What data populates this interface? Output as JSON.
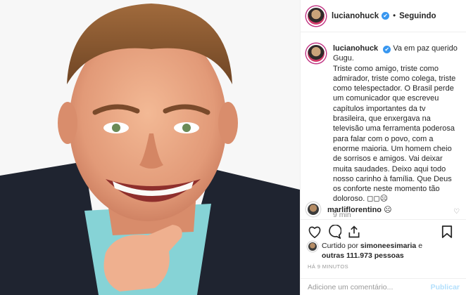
{
  "header": {
    "username": "lucianohuck",
    "verified_badge": "✔",
    "separator": "•",
    "follow_label": "Seguindo"
  },
  "caption": {
    "username": "lucianohuck",
    "first_line": "Va em paz querido Gugu.",
    "body": "Triste como amigo, triste como admirador, triste como colega, triste como telespectador. O Brasil perde um comunicador que escreveu capítulos importantes da tv brasileira, que enxergava na televisão uma ferramenta poderosa para falar com o povo, com a enorme maioria. Um homem cheio de sorrisos e amigos. Vai deixar muita saudades. Deixo aqui todo nosso carinho à família. Que Deus os conforte neste momento tão doloroso. ◻◻☹",
    "time": "9 min"
  },
  "comment": {
    "username": "marliflorentino",
    "text": "☹"
  },
  "likes": {
    "prefix": "Curtido por",
    "user": "simoneesimaria",
    "middle": "e",
    "others": "outras 111.973 pessoas"
  },
  "timestamp": "HÁ 9 MINUTOS",
  "add_comment": {
    "placeholder": "Adicione um comentário...",
    "publish_label": "Publicar"
  },
  "icons": [
    "heart-icon",
    "comment-icon",
    "share-icon",
    "bookmark-icon",
    "verified-icon"
  ],
  "colors": {
    "accent": "#3897f0",
    "muted": "#8e8e8e",
    "publish_disabled": "#b2dffc"
  }
}
